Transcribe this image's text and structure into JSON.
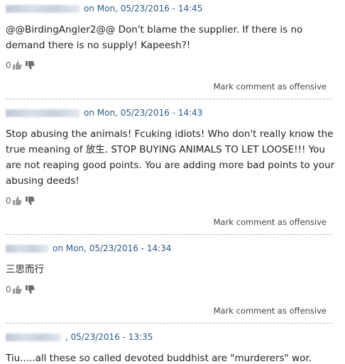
{
  "comments": [
    {
      "date_prefix": "on Mon, 05/23/2016 - 14:45",
      "body": "@@BirdingAngler2@@ Don't blame the supplier. If there is no demand there is no supply! Kapeesh?!",
      "votes": "0",
      "offensive_label": "Mark comment as offensive"
    },
    {
      "date_prefix": "on Mon, 05/23/2016 - 14:43",
      "body": "Stop abusing the animals! Fcuking idiots! Who don't really know the true meaning of 放生. STOP BUYING ANIMALS TO LET LOOSE!!! You are not reaping good points. You are adding more bad points to your abusing deeds!",
      "votes": "0",
      "offensive_label": "Mark comment as offensive"
    },
    {
      "date_prefix": "on Mon, 05/23/2016 - 14:34",
      "body": "三思而行",
      "votes": "0",
      "offensive_label": "Mark comment as offensive"
    },
    {
      "date_prefix": ", 05/23/2016 - 13:35",
      "body": "Tiu.....all these so called devoted buddhist are \"murderers\" wor.",
      "votes": "",
      "offensive_label": ""
    }
  ],
  "icons": {
    "like": "thumbs-up-icon",
    "dislike": "thumbs-down-icon"
  },
  "colors": {
    "meta": "#2a5a86",
    "text": "#222222",
    "divider": "#b8b8b8"
  }
}
